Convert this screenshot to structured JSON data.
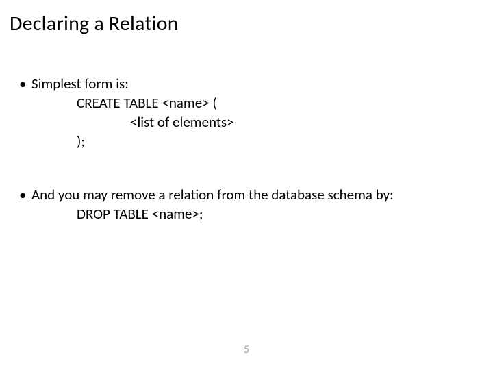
{
  "title": "Declaring a Relation",
  "bullets": {
    "b1": {
      "dot": "•",
      "text": "Simplest form is:",
      "line1": "CREATE TABLE <name> (",
      "line2": "<list of elements>",
      "line3": ");"
    },
    "b2": {
      "dot": "•",
      "text": "And you may remove a relation from the database schema by:",
      "line1": "DROP TABLE <name>;"
    }
  },
  "pageNumber": "5"
}
